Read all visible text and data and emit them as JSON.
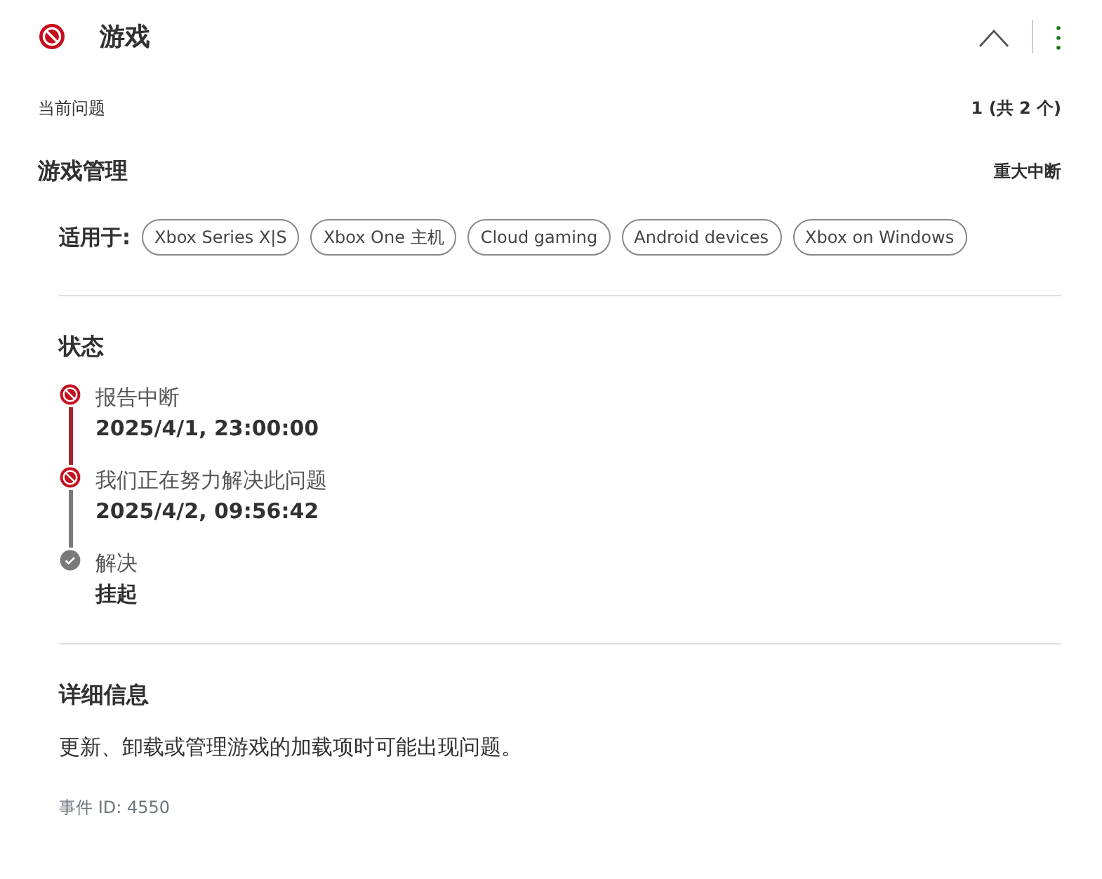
{
  "header": {
    "title": "游戏",
    "kind": "outage"
  },
  "current": {
    "label": "当前问题",
    "count": "1 (共 2 个)"
  },
  "issue": {
    "title": "游戏管理",
    "severity": "重大中断"
  },
  "applies": {
    "label": "适用于:",
    "tags": [
      "Xbox Series X|S",
      "Xbox One 主机",
      "Cloud gaming",
      "Android devices",
      "Xbox on Windows"
    ]
  },
  "status": {
    "heading": "状态",
    "steps": [
      {
        "kind": "outage",
        "label": "报告中断",
        "value": "2025/4/1, 23:00:00"
      },
      {
        "kind": "working",
        "label": "我们正在努力解决此问题",
        "value": "2025/4/2, 09:56:42"
      },
      {
        "kind": "resolved",
        "label": "解决",
        "value": "挂起"
      }
    ]
  },
  "details": {
    "heading": "详细信息",
    "text": "更新、卸载或管理游戏的加载项时可能出现问题。",
    "event": "事件 ID: 4550"
  }
}
